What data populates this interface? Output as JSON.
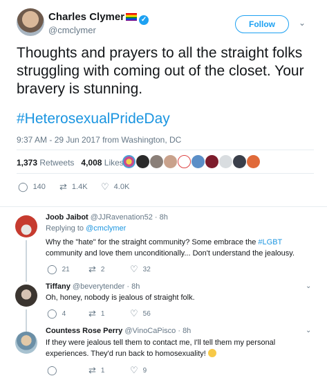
{
  "tweet": {
    "author_name": "Charles Clymer",
    "author_handle": "@cmclymer",
    "follow_label": "Follow",
    "text": "Thoughts and prayers to all the straight folks struggling with coming out of the closet. Your bravery is stunning.",
    "hashtag": "#HeterosexualPrideDay",
    "timestamp": "9:37 AM - 29 Jun 2017 from Washington, DC",
    "retweets_count": "1,373",
    "retweets_label": "Retweets",
    "likes_count": "4,008",
    "likes_label": "Likes",
    "actions": {
      "replies": "140",
      "retweets": "1.4K",
      "likes": "4.0K"
    }
  },
  "replies": [
    {
      "name": "Joob Jaibot",
      "handle": "@JJRavenation52",
      "time": "8h",
      "replying_to_prefix": "Replying to",
      "replying_to": "@cmclymer",
      "text_before": "Why the \"hate\" for the straight community? Some embrace the ",
      "link": "#LGBT",
      "text_after": " community and love them unconditionally... Don't understand the jealousy.",
      "actions": {
        "replies": "21",
        "retweets": "2",
        "likes": "32"
      }
    },
    {
      "name": "Tiffany",
      "handle": "@beverytender",
      "time": "8h",
      "text": "Oh, honey, nobody is jealous of straight folk.",
      "actions": {
        "replies": "4",
        "retweets": "1",
        "likes": "56"
      }
    },
    {
      "name": "Countess Rose Perry",
      "handle": "@VinoCaPisco",
      "time": "8h",
      "text": "If they were jealous tell them to contact me, I'll tell them my personal experiences. They'd  run back to homosexuality!",
      "actions": {
        "retweets": "1",
        "likes": "9"
      }
    }
  ],
  "icons": {
    "reply": "reply-icon",
    "retweet": "retweet-icon",
    "like": "heart-icon",
    "more": "chevron-down-icon",
    "verified": "verified-badge-icon"
  },
  "colors": {
    "accent": "#1da1f2",
    "link": "#1b95e0",
    "muted": "#657786",
    "text": "#14171a"
  }
}
